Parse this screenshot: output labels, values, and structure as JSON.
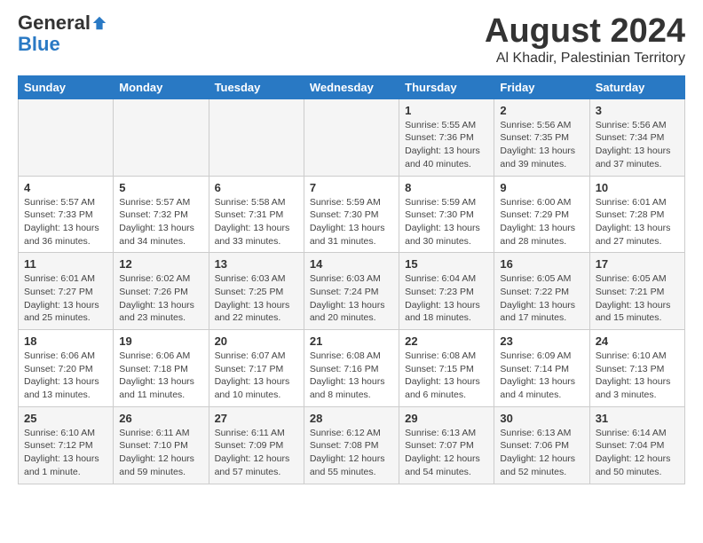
{
  "header": {
    "logo_general": "General",
    "logo_blue": "Blue",
    "month_title": "August 2024",
    "location": "Al Khadir, Palestinian Territory"
  },
  "weekdays": [
    "Sunday",
    "Monday",
    "Tuesday",
    "Wednesday",
    "Thursday",
    "Friday",
    "Saturday"
  ],
  "weeks": [
    [
      {
        "day": "",
        "info": ""
      },
      {
        "day": "",
        "info": ""
      },
      {
        "day": "",
        "info": ""
      },
      {
        "day": "",
        "info": ""
      },
      {
        "day": "1",
        "info": "Sunrise: 5:55 AM\nSunset: 7:36 PM\nDaylight: 13 hours\nand 40 minutes."
      },
      {
        "day": "2",
        "info": "Sunrise: 5:56 AM\nSunset: 7:35 PM\nDaylight: 13 hours\nand 39 minutes."
      },
      {
        "day": "3",
        "info": "Sunrise: 5:56 AM\nSunset: 7:34 PM\nDaylight: 13 hours\nand 37 minutes."
      }
    ],
    [
      {
        "day": "4",
        "info": "Sunrise: 5:57 AM\nSunset: 7:33 PM\nDaylight: 13 hours\nand 36 minutes."
      },
      {
        "day": "5",
        "info": "Sunrise: 5:57 AM\nSunset: 7:32 PM\nDaylight: 13 hours\nand 34 minutes."
      },
      {
        "day": "6",
        "info": "Sunrise: 5:58 AM\nSunset: 7:31 PM\nDaylight: 13 hours\nand 33 minutes."
      },
      {
        "day": "7",
        "info": "Sunrise: 5:59 AM\nSunset: 7:30 PM\nDaylight: 13 hours\nand 31 minutes."
      },
      {
        "day": "8",
        "info": "Sunrise: 5:59 AM\nSunset: 7:30 PM\nDaylight: 13 hours\nand 30 minutes."
      },
      {
        "day": "9",
        "info": "Sunrise: 6:00 AM\nSunset: 7:29 PM\nDaylight: 13 hours\nand 28 minutes."
      },
      {
        "day": "10",
        "info": "Sunrise: 6:01 AM\nSunset: 7:28 PM\nDaylight: 13 hours\nand 27 minutes."
      }
    ],
    [
      {
        "day": "11",
        "info": "Sunrise: 6:01 AM\nSunset: 7:27 PM\nDaylight: 13 hours\nand 25 minutes."
      },
      {
        "day": "12",
        "info": "Sunrise: 6:02 AM\nSunset: 7:26 PM\nDaylight: 13 hours\nand 23 minutes."
      },
      {
        "day": "13",
        "info": "Sunrise: 6:03 AM\nSunset: 7:25 PM\nDaylight: 13 hours\nand 22 minutes."
      },
      {
        "day": "14",
        "info": "Sunrise: 6:03 AM\nSunset: 7:24 PM\nDaylight: 13 hours\nand 20 minutes."
      },
      {
        "day": "15",
        "info": "Sunrise: 6:04 AM\nSunset: 7:23 PM\nDaylight: 13 hours\nand 18 minutes."
      },
      {
        "day": "16",
        "info": "Sunrise: 6:05 AM\nSunset: 7:22 PM\nDaylight: 13 hours\nand 17 minutes."
      },
      {
        "day": "17",
        "info": "Sunrise: 6:05 AM\nSunset: 7:21 PM\nDaylight: 13 hours\nand 15 minutes."
      }
    ],
    [
      {
        "day": "18",
        "info": "Sunrise: 6:06 AM\nSunset: 7:20 PM\nDaylight: 13 hours\nand 13 minutes."
      },
      {
        "day": "19",
        "info": "Sunrise: 6:06 AM\nSunset: 7:18 PM\nDaylight: 13 hours\nand 11 minutes."
      },
      {
        "day": "20",
        "info": "Sunrise: 6:07 AM\nSunset: 7:17 PM\nDaylight: 13 hours\nand 10 minutes."
      },
      {
        "day": "21",
        "info": "Sunrise: 6:08 AM\nSunset: 7:16 PM\nDaylight: 13 hours\nand 8 minutes."
      },
      {
        "day": "22",
        "info": "Sunrise: 6:08 AM\nSunset: 7:15 PM\nDaylight: 13 hours\nand 6 minutes."
      },
      {
        "day": "23",
        "info": "Sunrise: 6:09 AM\nSunset: 7:14 PM\nDaylight: 13 hours\nand 4 minutes."
      },
      {
        "day": "24",
        "info": "Sunrise: 6:10 AM\nSunset: 7:13 PM\nDaylight: 13 hours\nand 3 minutes."
      }
    ],
    [
      {
        "day": "25",
        "info": "Sunrise: 6:10 AM\nSunset: 7:12 PM\nDaylight: 13 hours\nand 1 minute."
      },
      {
        "day": "26",
        "info": "Sunrise: 6:11 AM\nSunset: 7:10 PM\nDaylight: 12 hours\nand 59 minutes."
      },
      {
        "day": "27",
        "info": "Sunrise: 6:11 AM\nSunset: 7:09 PM\nDaylight: 12 hours\nand 57 minutes."
      },
      {
        "day": "28",
        "info": "Sunrise: 6:12 AM\nSunset: 7:08 PM\nDaylight: 12 hours\nand 55 minutes."
      },
      {
        "day": "29",
        "info": "Sunrise: 6:13 AM\nSunset: 7:07 PM\nDaylight: 12 hours\nand 54 minutes."
      },
      {
        "day": "30",
        "info": "Sunrise: 6:13 AM\nSunset: 7:06 PM\nDaylight: 12 hours\nand 52 minutes."
      },
      {
        "day": "31",
        "info": "Sunrise: 6:14 AM\nSunset: 7:04 PM\nDaylight: 12 hours\nand 50 minutes."
      }
    ]
  ]
}
